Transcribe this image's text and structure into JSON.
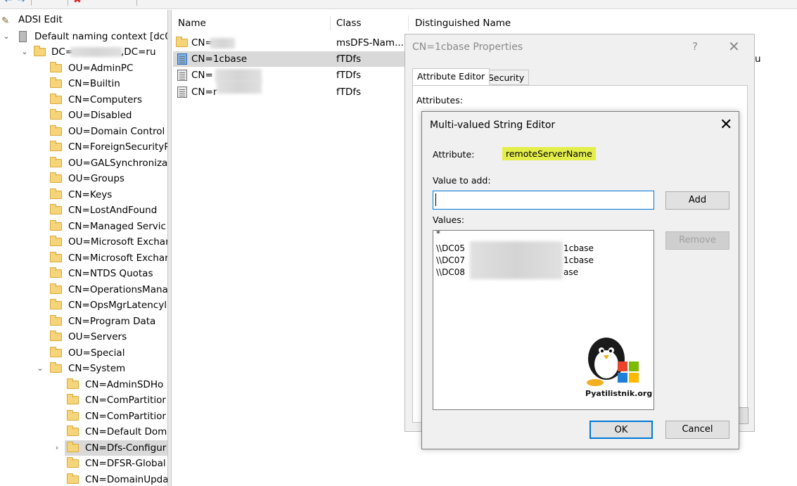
{
  "toolbar": {
    "items": [
      "back-arrow",
      "forward-arrow",
      "folder",
      "show-tree",
      "delete",
      "properties",
      "refresh",
      "export",
      "help",
      "console"
    ]
  },
  "tree": {
    "root_label": "ADSI Edit",
    "naming_context": "Default naming context [dc0",
    "domain_prefix": "DC=",
    "domain_suffix": ",DC=ru",
    "items": [
      "OU=AdminPC",
      "CN=Builtin",
      "CN=Computers",
      "OU=Disabled",
      "OU=Domain Control",
      "CN=ForeignSecurityP",
      "OU=GALSynchroniza",
      "OU=Groups",
      "CN=Keys",
      "CN=LostAndFound",
      "CN=Managed Servic",
      "OU=Microsoft Exchar",
      "CN=Microsoft Exchar",
      "CN=NTDS Quotas",
      "CN=OperationsMana",
      "CN=OpsMgrLatencyl",
      "CN=Program Data",
      "OU=Servers",
      "OU=Special",
      "CN=System"
    ],
    "system_children": [
      "CN=AdminSDHo",
      "CN=ComPartitior",
      "CN=ComPartitior",
      "CN=Default Dom",
      "CN=Dfs-Configur",
      "CN=DFSR-Global",
      "CN=DomainUpda"
    ]
  },
  "list": {
    "headers": {
      "name": "Name",
      "class": "Class",
      "dn": "Distinguished Name"
    },
    "rows": [
      {
        "name": "CN=",
        "class": "msDFS-Nam...",
        "dn": ""
      },
      {
        "name": "CN=1cbase",
        "class": "fTDfs",
        "dn": "u"
      },
      {
        "name": "CN=",
        "class": "fTDfs",
        "dn": ""
      },
      {
        "name": "CN=r",
        "class": "fTDfs",
        "dn": ""
      }
    ]
  },
  "props_dialog": {
    "title": "CN=1cbase Properties",
    "help": "?",
    "close": "✕",
    "tabs": [
      "Attribute Editor",
      "Security"
    ],
    "attributes_label": "Attributes:"
  },
  "editor": {
    "title": "Multi-valued String Editor",
    "close": "✕",
    "attribute_label": "Attribute:",
    "attribute_value": "remoteServerName",
    "value_to_add_label": "Value to add:",
    "value_to_add": "",
    "add_button": "Add",
    "values_label": "Values:",
    "remove_button": "Remove",
    "values": [
      "*",
      "\\\\DC05",
      "1cbase",
      "\\\\DC07",
      "1cbase",
      "\\\\DC08",
      "ase"
    ],
    "ok_button": "OK",
    "cancel_button": "Cancel"
  },
  "watermark": {
    "text": "Pyatilistnik.org"
  },
  "colors": {
    "highlight": "#e4ee4a",
    "focus": "#0078d7",
    "selection": "#d9d9d9"
  }
}
